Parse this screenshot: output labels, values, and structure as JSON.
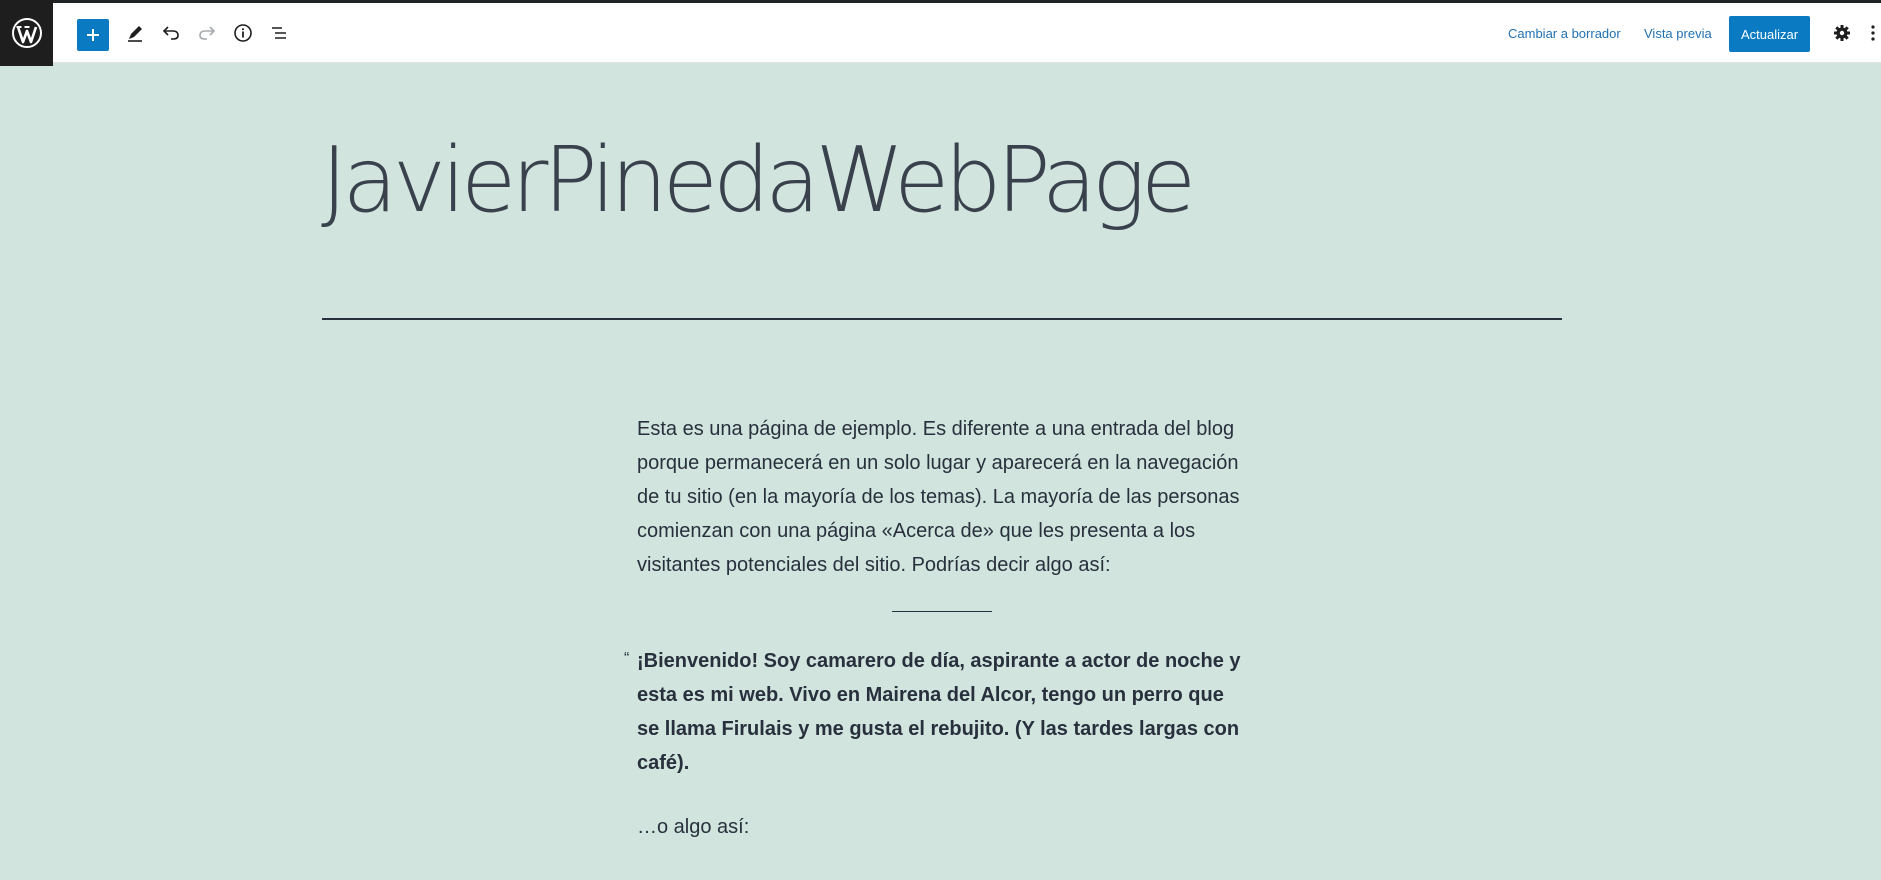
{
  "toolbar": {
    "logo_icon": "wordpress-logo-icon",
    "add_icon": "plus-icon",
    "edit_icon": "pencil-icon",
    "undo_icon": "undo-icon",
    "redo_icon": "redo-icon",
    "info_icon": "info-icon",
    "list_view_icon": "list-view-icon",
    "switch_to_draft_label": "Cambiar a borrador",
    "preview_label": "Vista previa",
    "update_label": "Actualizar",
    "settings_icon": "gear-icon",
    "more_icon": "more-vertical-icon",
    "accent_color": "#0a7bc2"
  },
  "editor": {
    "background_color": "#d1e4dd",
    "title": "JavierPinedaWebPage",
    "paragraph_1": "Esta es una página de ejemplo. Es diferente a una entrada del blog porque permanecerá en un solo lugar y aparecerá en la navegación de tu sitio (en la mayoría de los temas). La mayoría de las personas comienzan con una página «Acerca de» que les presenta a los visitantes potenciales del sitio. Podrías decir algo así:",
    "quote_mark": "“",
    "quote": "¡Bienvenido! Soy camarero de día, aspirante a actor de noche y esta es mi web. Vivo en Mairena del Alcor, tengo un perro que se llama Firulais y me gusta el rebujito. (Y las tardes largas con café).",
    "paragraph_2": "…o algo así:"
  }
}
